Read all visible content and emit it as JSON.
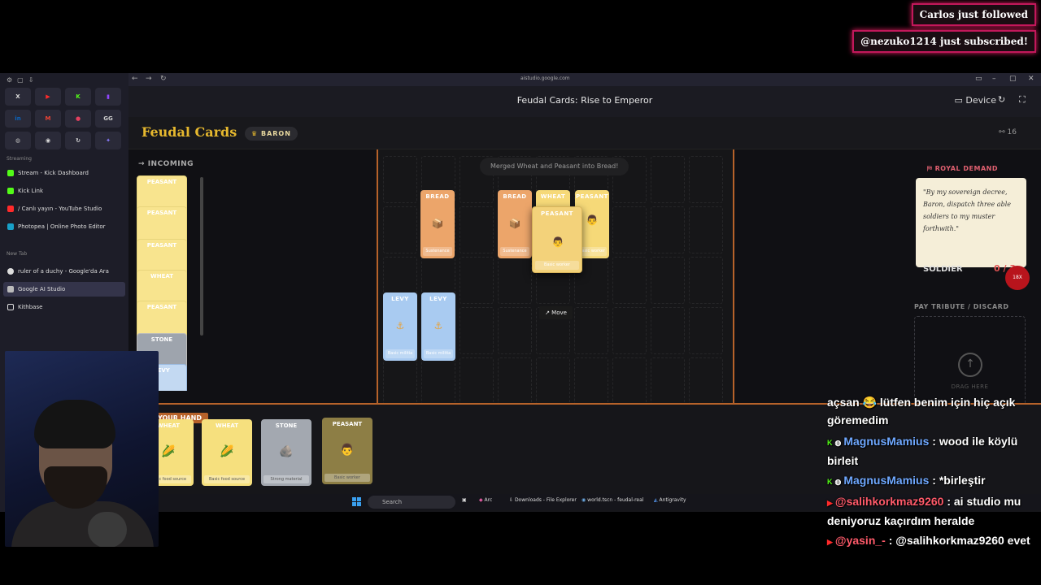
{
  "alerts": {
    "follow": "Carlos just followed",
    "subscribe": "@nezuko1214 just subscribed!"
  },
  "browser": {
    "url": "aistudio.google.com",
    "sidebar": {
      "section_streaming": "Streaming",
      "section_new_tab": "New Tab",
      "pins": [
        "X",
        "",
        "K",
        "",
        "in",
        "",
        "",
        "GG",
        "",
        "",
        "",
        ""
      ],
      "tabs_streaming": [
        {
          "label": "Stream - Kick Dashboard",
          "color": "#53fc18"
        },
        {
          "label": "Kick Link",
          "color": "#53fc18"
        },
        {
          "label": "/ Canlı yayın - YouTube Studio",
          "color": "#ff2a2a"
        },
        {
          "label": "Photopea | Online Photo Editor",
          "color": "#18a0c8"
        }
      ],
      "tabs_new": [
        {
          "label": "ruler of a duchy - Google'da Ara",
          "color": "#dddddd"
        },
        {
          "label": "Google AI Studio",
          "color": "#dddddd",
          "active": true
        },
        {
          "label": "Kithbase",
          "color": "#dddddd"
        }
      ]
    }
  },
  "studio": {
    "title": "Feudal Cards: Rise to Emperor",
    "device_label": "Device"
  },
  "game": {
    "logo": "Feudal Cards",
    "rank": "BARON",
    "count": "16",
    "incoming_label": "INCOMING",
    "incoming_cards": [
      {
        "label": "PEASANT",
        "kind": "yellow"
      },
      {
        "label": "PEASANT",
        "kind": "yellow"
      },
      {
        "label": "PEASANT",
        "kind": "yellow"
      },
      {
        "label": "WHEAT",
        "kind": "yellow"
      },
      {
        "label": "PEASANT",
        "kind": "yellow"
      },
      {
        "label": "STONE",
        "kind": "stone"
      },
      {
        "label": "LEVY",
        "kind": "blue"
      }
    ],
    "toast": "Merged Wheat and Peasant into Bread!",
    "board_cards": {
      "bread1": {
        "title": "BREAD",
        "footer": "Sustenance"
      },
      "bread2": {
        "title": "BREAD",
        "footer": "Sustenance"
      },
      "wheat": {
        "title": "WHEAT",
        "footer": ""
      },
      "peasant": {
        "title": "PEASANT",
        "footer": "Basic worker"
      },
      "dragging": {
        "title": "PEASANT",
        "footer": "Basic worker"
      },
      "levy1": {
        "title": "LEVY",
        "footer": "Basic militia"
      },
      "levy2": {
        "title": "LEVY",
        "footer": "Basic militia"
      }
    },
    "move_tooltip": "Move",
    "royal_demand": {
      "label": "ROYAL DEMAND",
      "quote": "\"By my sovereign decree, Baron, dispatch three able soldiers to my muster forthwith.\"",
      "type": "SOLDIER",
      "progress": "0 / 3",
      "badge": "18X"
    },
    "tribute": {
      "label": "PAY TRIBUTE / DISCARD",
      "drag_text": "DRAG HERE"
    },
    "hand": {
      "label": "YOUR HAND",
      "cards": [
        {
          "title": "WHEAT",
          "footer": "Basic food source",
          "kind": "yellow",
          "icon": "🌽"
        },
        {
          "title": "WHEAT",
          "footer": "Basic food source",
          "kind": "yellow",
          "icon": "🌽"
        },
        {
          "title": "STONE",
          "footer": "Strong material",
          "kind": "stone",
          "icon": "🪨"
        },
        {
          "title": "PEASANT",
          "footer": "Basic worker",
          "kind": "olive",
          "icon": "👨"
        }
      ]
    }
  },
  "taskbar": {
    "search": "Search",
    "items": [
      "Arc",
      "Downloads - File Explorer",
      "world.tscn - feudal-real",
      "Antigravity"
    ]
  },
  "chat": [
    {
      "user": "",
      "text": "açsan 😂 lütfen benim için hiç açık göremedim",
      "platform": ""
    },
    {
      "user": "MagnusMamius",
      "text": ": wood ile köylü birleit",
      "platform": "kick"
    },
    {
      "user": "MagnusMamius",
      "text": ": *birleştir",
      "platform": "kick"
    },
    {
      "user": "@salihkorkmaz9260",
      "text": ": ai studio mu deniyoruz kaçırdım heralde",
      "platform": "youtube"
    },
    {
      "user": "@yasin_-",
      "text": ": @salihkorkmaz9260 evet",
      "platform": "youtube"
    }
  ]
}
